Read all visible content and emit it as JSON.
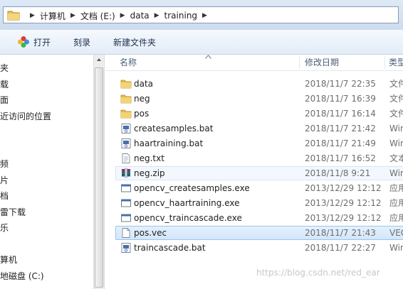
{
  "address": {
    "crumbs": [
      "计算机",
      "文档 (E:)",
      "data",
      "training"
    ]
  },
  "toolbar": {
    "open_label": "打开",
    "burn_label": "刻录",
    "new_folder_label": "新建文件夹"
  },
  "nav": {
    "items": [
      "藏夹",
      "下载",
      "桌面",
      "最近访问的位置",
      "",
      "",
      "视频",
      "图片",
      "文档",
      "迅雷下载",
      "音乐",
      "",
      "计算机",
      "本地磁盘 (C:)"
    ]
  },
  "columns": {
    "name": "名称",
    "date": "修改日期",
    "type": "类型"
  },
  "files": [
    {
      "name": "data",
      "date": "2018/11/7 22:35",
      "type": "文件",
      "icon": "folder-icon"
    },
    {
      "name": "neg",
      "date": "2018/11/7 16:39",
      "type": "文件",
      "icon": "folder-icon"
    },
    {
      "name": "pos",
      "date": "2018/11/7 16:14",
      "type": "文件",
      "icon": "folder-icon"
    },
    {
      "name": "createsamples.bat",
      "date": "2018/11/7 21:42",
      "type": "Win",
      "icon": "bat-file-icon"
    },
    {
      "name": "haartraining.bat",
      "date": "2018/11/7 21:49",
      "type": "Win",
      "icon": "bat-file-icon"
    },
    {
      "name": "neg.txt",
      "date": "2018/11/7 16:52",
      "type": "文本",
      "icon": "text-file-icon"
    },
    {
      "name": "neg.zip",
      "date": "2018/11/8 9:21",
      "type": "Win",
      "icon": "zip-archive-icon"
    },
    {
      "name": "opencv_createsamples.exe",
      "date": "2013/12/29 12:12",
      "type": "应用",
      "icon": "exe-file-icon"
    },
    {
      "name": "opencv_haartraining.exe",
      "date": "2013/12/29 12:12",
      "type": "应用",
      "icon": "exe-file-icon"
    },
    {
      "name": "opencv_traincascade.exe",
      "date": "2013/12/29 12:12",
      "type": "应用",
      "icon": "exe-file-icon"
    },
    {
      "name": "pos.vec",
      "date": "2018/11/7 21:43",
      "type": "VEC",
      "icon": "blank-file-icon"
    },
    {
      "name": "traincascade.bat",
      "date": "2018/11/7 22:27",
      "type": "Win",
      "icon": "bat-file-icon"
    }
  ],
  "watermark": "https://blog.csdn.net/red_ear"
}
